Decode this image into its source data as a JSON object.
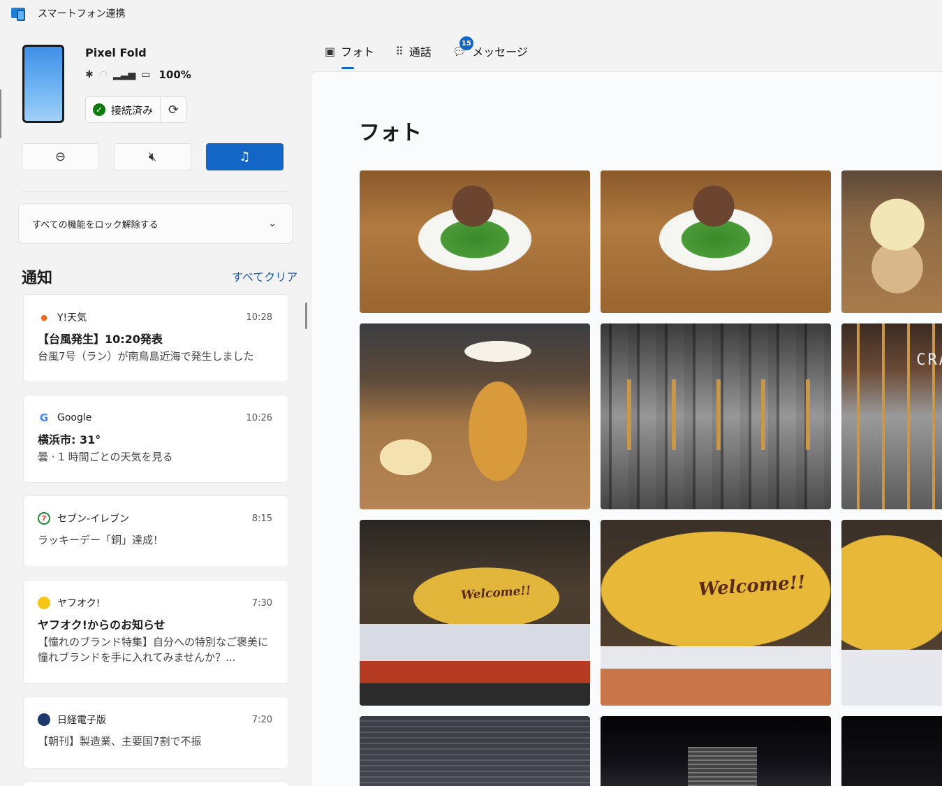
{
  "window": {
    "title": "スマートフォン連携"
  },
  "device": {
    "name": "Pixel Fold",
    "battery": "100%",
    "connection_label": "接続済み"
  },
  "quick_actions": [
    {
      "icon": "do-not-disturb-icon"
    },
    {
      "icon": "mute-icon"
    },
    {
      "icon": "music-note-icon",
      "active": true
    }
  ],
  "unlock": {
    "label": "すべての機能をロック解除する"
  },
  "notifications": {
    "title": "通知",
    "clear_all": "すべてクリア",
    "items": [
      {
        "app": "Y!天気",
        "time": "10:28",
        "title": "【台風発生】10:20発表",
        "body": "台風7号（ラン）が南鳥島近海で発生しました"
      },
      {
        "app": "Google",
        "time": "10:26",
        "title": "横浜市: 31°",
        "body": "曇 · 1 時間ごとの天気を見る"
      },
      {
        "app": "セブン-イレブン",
        "time": "8:15",
        "title": "",
        "body": "ラッキーデー「銅」達成！"
      },
      {
        "app": "ヤフオク!",
        "time": "7:30",
        "title": "ヤフオク!からのお知らせ",
        "body": "【憧れのブランド特集】自分への特別なご褒美に憧れブランドを手に入れてみませんか？..."
      },
      {
        "app": "日経電子版",
        "time": "7:20",
        "title": "",
        "body": "【朝刊】製造業、主要国7割で不振"
      }
    ]
  },
  "tabs": [
    {
      "label": "フォト",
      "icon": "photo-icon",
      "active": true
    },
    {
      "label": "通話",
      "icon": "dialpad-icon"
    },
    {
      "label": "メッセージ",
      "icon": "message-icon",
      "badge": "15"
    }
  ],
  "photos": {
    "title": "フォト",
    "sign_texts": {
      "welcome": "Welcome!!",
      "craft": "CRA"
    }
  },
  "colors": {
    "accent": "#1466c6",
    "connected": "#0f7b0f"
  }
}
